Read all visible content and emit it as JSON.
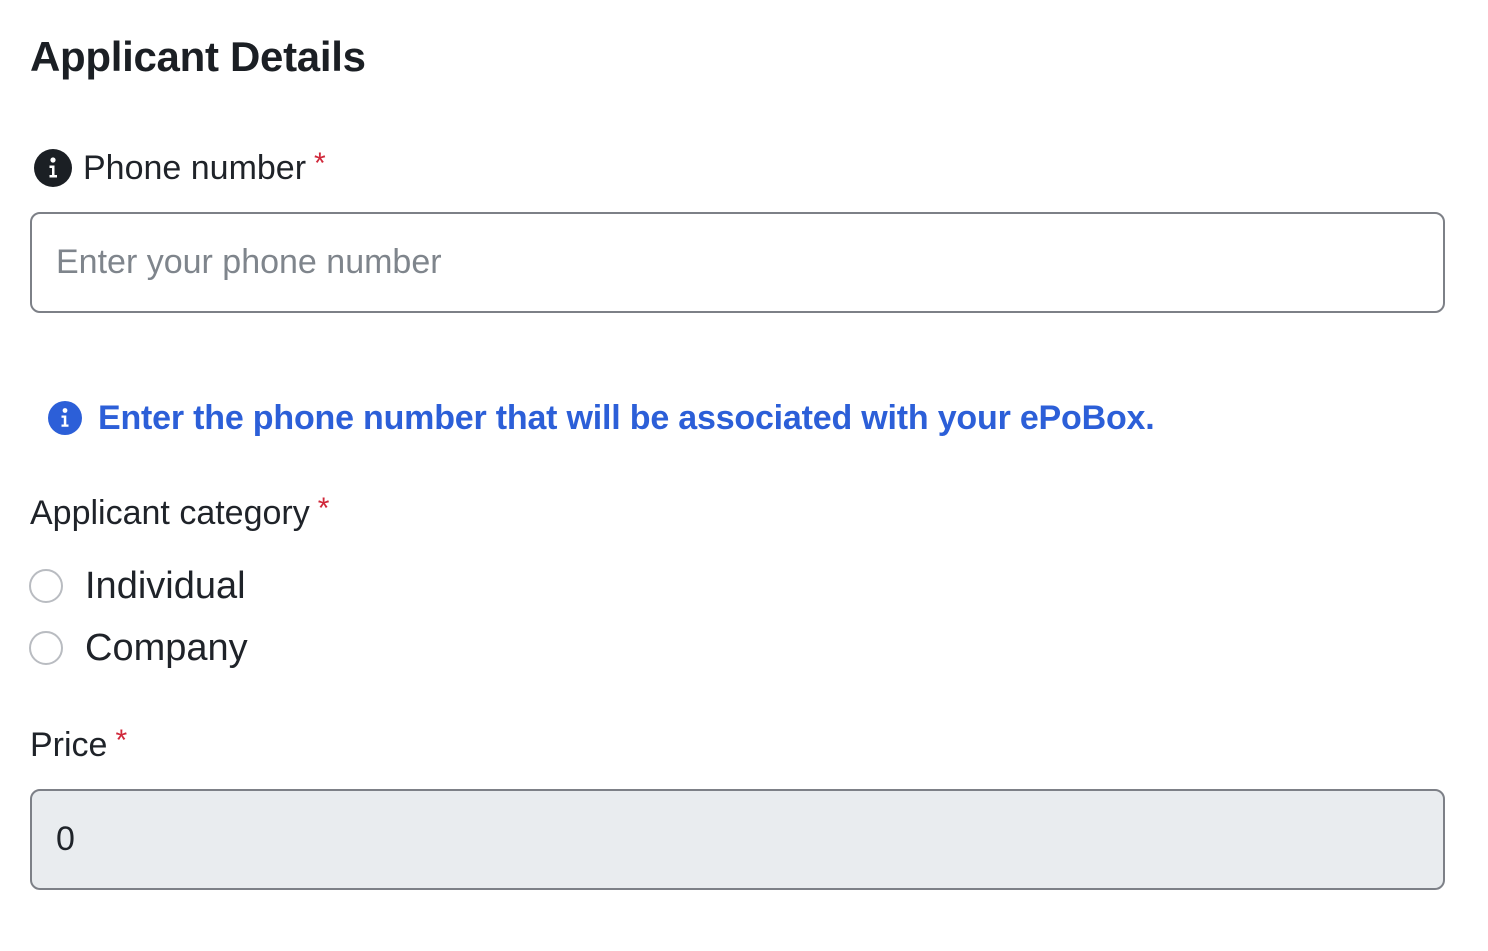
{
  "form": {
    "title": "Applicant Details",
    "phone": {
      "label": "Phone number",
      "required_mark": "*",
      "placeholder": "Enter your phone number",
      "value": "",
      "info_icon": "info-circle-icon"
    },
    "hint": {
      "text": "Enter the phone number that will be associated with your ePoBox.",
      "icon": "info-circle-icon"
    },
    "category": {
      "label": "Applicant category",
      "required_mark": "*",
      "options": [
        {
          "label": "Individual",
          "selected": false
        },
        {
          "label": "Company",
          "selected": false
        }
      ]
    },
    "price": {
      "label": "Price",
      "required_mark": "*",
      "value": "0",
      "readonly": true
    }
  },
  "colors": {
    "text": "#1f2329",
    "required": "#d0283a",
    "hint": "#2c5fd8",
    "input_border": "#7d8087",
    "readonly_bg": "#e9ecef"
  }
}
